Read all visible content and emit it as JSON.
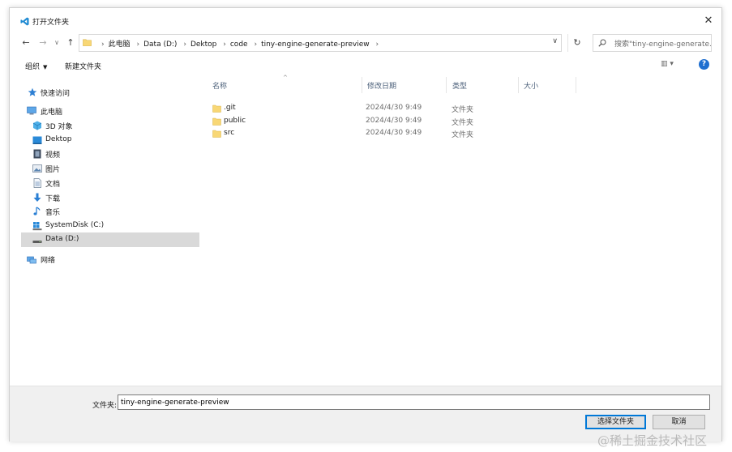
{
  "window": {
    "title": "打开文件夹",
    "close_glyph": "✕"
  },
  "navigation": {
    "back_glyph": "←",
    "forward_glyph": "→",
    "recent_glyph": "∨",
    "up_glyph": "↑",
    "breadcrumbs": [
      "此电脑",
      "Data (D:)",
      "Dektop",
      "code",
      "tiny-engine-generate-preview"
    ],
    "separator": "›",
    "dropdown_glyph": "∨",
    "refresh_glyph": "↻",
    "search_placeholder": "搜索\"tiny-engine-generate..."
  },
  "toolbar": {
    "organize_label": "组织",
    "organize_caret": "▼",
    "new_folder_label": "新建文件夹",
    "view_glyph": "▥ ▾",
    "help_glyph": "?"
  },
  "sidebar": {
    "items": [
      {
        "label": "快速访问",
        "icon": "star-icon"
      },
      {
        "label": "此电脑",
        "icon": "computer-icon"
      },
      {
        "label": "3D 对象",
        "icon": "cube-icon"
      },
      {
        "label": "Dektop",
        "icon": "desktop-icon"
      },
      {
        "label": "视频",
        "icon": "video-icon"
      },
      {
        "label": "图片",
        "icon": "picture-icon"
      },
      {
        "label": "文档",
        "icon": "document-icon"
      },
      {
        "label": "下载",
        "icon": "download-icon"
      },
      {
        "label": "音乐",
        "icon": "music-icon"
      },
      {
        "label": "SystemDisk (C:)",
        "icon": "system-drive-icon"
      },
      {
        "label": "Data (D:)",
        "icon": "drive-icon",
        "selected": true
      },
      {
        "label": "网络",
        "icon": "network-icon"
      }
    ]
  },
  "file_list": {
    "sort_glyph": "^",
    "columns": {
      "name": "名称",
      "date": "修改日期",
      "type": "类型",
      "size": "大小"
    },
    "rows": [
      {
        "name": ".git",
        "date": "2024/4/30 9:49",
        "type": "文件夹"
      },
      {
        "name": "public",
        "date": "2024/4/30 9:49",
        "type": "文件夹"
      },
      {
        "name": "src",
        "date": "2024/4/30 9:49",
        "type": "文件夹"
      }
    ]
  },
  "footer": {
    "folder_label": "文件夹:",
    "folder_value": "tiny-engine-generate-preview",
    "select_button": "选择文件夹",
    "cancel_button": "取消"
  },
  "watermark": "@稀土掘金技术社区",
  "colors": {
    "accent": "#0078d7",
    "folder": "#f8d775",
    "selected_row": "#d9d9d9",
    "help": "#1f6fd0"
  }
}
